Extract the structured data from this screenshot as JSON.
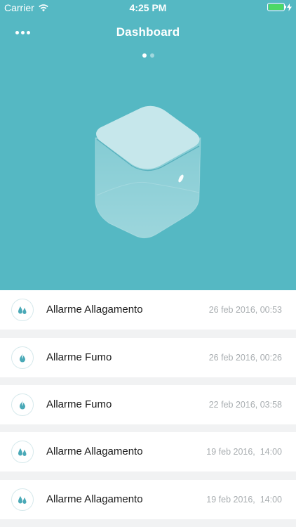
{
  "status_bar": {
    "carrier": "Carrier",
    "time": "4:25 PM",
    "battery_color": "#4cd964"
  },
  "navbar": {
    "title": "Dashboard",
    "more_icon": "ellipsis-icon"
  },
  "pager": {
    "count": 2,
    "active_index": 0
  },
  "colors": {
    "header_bg": "#55b8c3",
    "list_bg": "#f1f2f3",
    "accent": "#4aa9b7",
    "date_text": "#a8adb0"
  },
  "alarms": [
    {
      "title": "Allarme Allagamento",
      "date": "26 feb 2016, 00:53",
      "icon": "water-drops-icon"
    },
    {
      "title": "Allarme Fumo",
      "date": "26 feb 2016, 00:26",
      "icon": "flame-icon"
    },
    {
      "title": "Allarme Fumo",
      "date": "22 feb 2016, 03:58",
      "icon": "flame-icon"
    },
    {
      "title": "Allarme Allagamento",
      "date": "19 feb 2016,  14:00",
      "icon": "water-drops-icon"
    },
    {
      "title": "Allarme Allagamento",
      "date": "19 feb 2016,  14:00",
      "icon": "water-drops-icon"
    }
  ]
}
